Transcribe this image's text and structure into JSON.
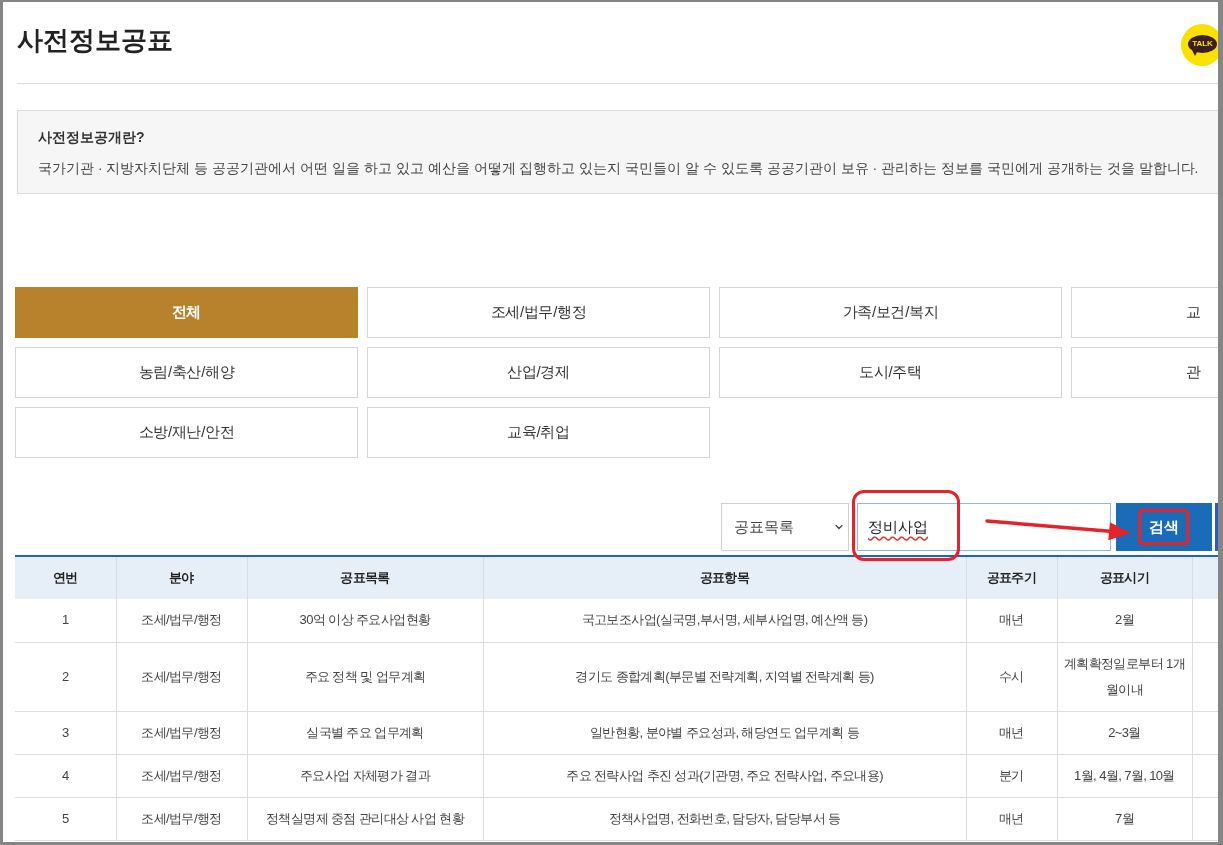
{
  "page": {
    "title": "사전정보공표",
    "chat_logo": {
      "label": "TALK"
    }
  },
  "intro": {
    "heading": "사전정보공개란?",
    "body": "국가기관 · 지방자치단체 등 공공기관에서 어떤 일을 하고 있고 예산을 어떻게 집행하고 있는지 국민들이 알 수 있도록 공공기관이 보유 · 관리하는 정보를 국민에게 공개하는 것을 말합니다."
  },
  "categories": [
    {
      "label": "전체",
      "selected": true
    },
    {
      "label": "조세/법무/행정",
      "selected": false
    },
    {
      "label": "가족/보건/복지",
      "selected": false
    },
    {
      "label": "교",
      "selected": false
    },
    {
      "label": "농림/축산/해양",
      "selected": false
    },
    {
      "label": "산업/경제",
      "selected": false
    },
    {
      "label": "도시/주택",
      "selected": false
    },
    {
      "label": "관",
      "selected": false
    },
    {
      "label": "소방/재난/안전",
      "selected": false
    },
    {
      "label": "교육/취업",
      "selected": false
    }
  ],
  "search": {
    "scope": "공표목록",
    "query": "정비사업",
    "query_misspelled": true,
    "query_highlighted": true,
    "button": {
      "label": "검색",
      "highlighted": true
    }
  },
  "table": {
    "columns": [
      "연번",
      "분야",
      "공표목록",
      "공표항목",
      "공표주기",
      "공표시기"
    ],
    "rows": [
      [
        "1",
        "조세/법무/행정",
        "30억 이상 주요사업현황",
        "국고보조사업(실국명,부서명, 세부사업명, 예산액 등)",
        "매년",
        "2월"
      ],
      [
        "2",
        "조세/법무/행정",
        "주요 정책 및 업무계획",
        "경기도 종합계획(부문별 전략계획, 지역별 전략계획 등)",
        "수시",
        "계획확정일로부터 1개월이내"
      ],
      [
        "3",
        "조세/법무/행정",
        "실국별 주요 업무계획",
        "일반현황, 분야별 주요성과, 해당연도 업무계획 등",
        "매년",
        "2~3월"
      ],
      [
        "4",
        "조세/법무/행정",
        "주요사업 자체평가 결과",
        "주요 전략사업 추진 성과(기관명, 주요 전략사업, 주요내용)",
        "분기",
        "1월, 4월, 7월, 10월"
      ],
      [
        "5",
        "조세/법무/행정",
        "정책실명제 중점 관리대상 사업 현황",
        "정책사업명, 전화번호, 담당자, 담당부서 등",
        "매년",
        "7월"
      ]
    ]
  }
}
